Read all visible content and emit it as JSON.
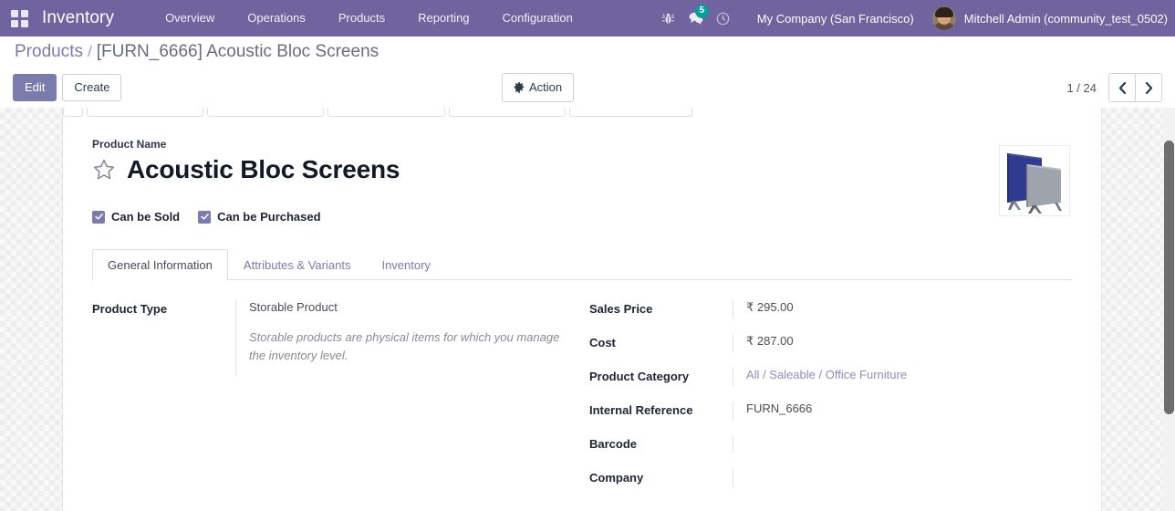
{
  "navbar": {
    "apps_icon": "apps-grid-icon",
    "brand": "Inventory",
    "menu_items": [
      {
        "label": "Overview"
      },
      {
        "label": "Operations"
      },
      {
        "label": "Products"
      },
      {
        "label": "Reporting"
      },
      {
        "label": "Configuration"
      }
    ],
    "system_icons": [
      {
        "name": "bug-icon",
        "glyph": "🐞"
      },
      {
        "name": "messages-icon",
        "glyph": "💬",
        "badge": "5"
      },
      {
        "name": "activities-clock-icon",
        "glyph": "◷"
      }
    ],
    "company": "My Company (San Francisco)",
    "user": "Mitchell Admin (community_test_0502)"
  },
  "breadcrumb": {
    "parent": "Products",
    "separator": "/",
    "current": "[FURN_6666] Acoustic Bloc Screens"
  },
  "control_panel": {
    "edit_label": "Edit",
    "create_label": "Create",
    "action_label": "Action",
    "action_icon": "gear-icon",
    "pager_text": "1 / 24",
    "prev_icon": "chevron-left-icon",
    "next_icon": "chevron-right-icon"
  },
  "form": {
    "name_label": "Product Name",
    "product_name": "Acoustic Bloc Screens",
    "favorite_icon": "star-outline-icon",
    "checkboxes": [
      {
        "label": "Can be Sold",
        "checked": true
      },
      {
        "label": "Can be Purchased",
        "checked": true
      }
    ],
    "image_alt": "acoustic-bloc-screens-photo",
    "tabs": [
      {
        "label": "General Information",
        "active": true
      },
      {
        "label": "Attributes & Variants",
        "active": false
      },
      {
        "label": "Inventory",
        "active": false
      }
    ],
    "left_fields": [
      {
        "label": "Product Type",
        "value": "Storable Product",
        "help": "Storable products are physical items for which you manage the inventory level."
      }
    ],
    "right_fields": [
      {
        "label": "Sales Price",
        "value": "₹ 295.00",
        "kind": "text"
      },
      {
        "label": "Cost",
        "value": "₹ 287.00",
        "kind": "text"
      },
      {
        "label": "Product Category",
        "value": "All / Saleable / Office Furniture",
        "kind": "link"
      },
      {
        "label": "Internal Reference",
        "value": "FURN_6666",
        "kind": "text"
      },
      {
        "label": "Barcode",
        "value": "",
        "kind": "text"
      },
      {
        "label": "Company",
        "value": "",
        "kind": "text"
      }
    ]
  },
  "colors": {
    "brand_purple": "#71639e",
    "accent_purple": "#7c7bad",
    "badge_teal": "#00a09d",
    "link_purple": "#8e8dbe"
  }
}
